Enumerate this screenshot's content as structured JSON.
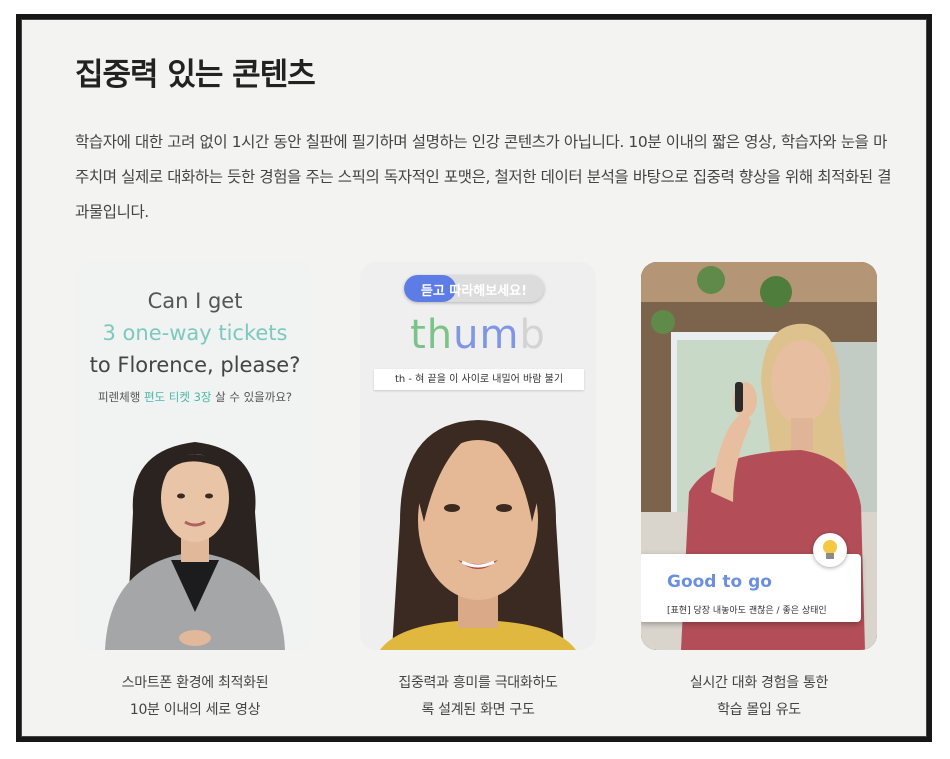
{
  "section": {
    "title": "집중력 있는 콘텐츠",
    "description": "학습자에 대한 고려 없이 1시간 동안 칠판에 필기하며 설명하는 인강 콘텐츠가 아닙니다. 10분 이내의 짧은 영상, 학습자와 눈을 마주치며 실제로 대화하는 듯한 경험을 주는 스픽의 독자적인 포맷은, 철저한 데이터 분석을 바탕으로 집중력 향상을 위해 최적화된 결과물입니다."
  },
  "cards": [
    {
      "line1": "Can I get",
      "line2": "3 one-way tickets",
      "line3": "to Florence, please?",
      "ko_before": "피렌체행 ",
      "ko_highlight": "편도 티켓 3장",
      "ko_after": " 살 수 있을까요?",
      "caption_line1": "스마트폰 환경에 최적화된",
      "caption_line2": "10분 이내의 세로 영상"
    },
    {
      "pill": "듣고 따라해보세요!",
      "word_part1": "th",
      "word_part2": "um",
      "word_part3": "b",
      "tip": "th - 혀 끝을 이 사이로 내밀어 바람 불기",
      "caption_line1": "집중력과 흥미를 극대화하도",
      "caption_line2": "록 설계된 화면 구도"
    },
    {
      "phrase": "Good to go",
      "phrase_sub": "[표현] 당장 내놓아도 괜찮은 / 좋은 상태인",
      "caption_line1": "실시간 대화 경험을 통한",
      "caption_line2": "학습 몰입 유도"
    }
  ],
  "colors": {
    "frame_border": "#171717",
    "panel_bg": "#f3f3f1",
    "accent_teal": "#7cc9bf",
    "accent_blue": "#5d7ce6",
    "accent_green": "#7cc38a"
  }
}
